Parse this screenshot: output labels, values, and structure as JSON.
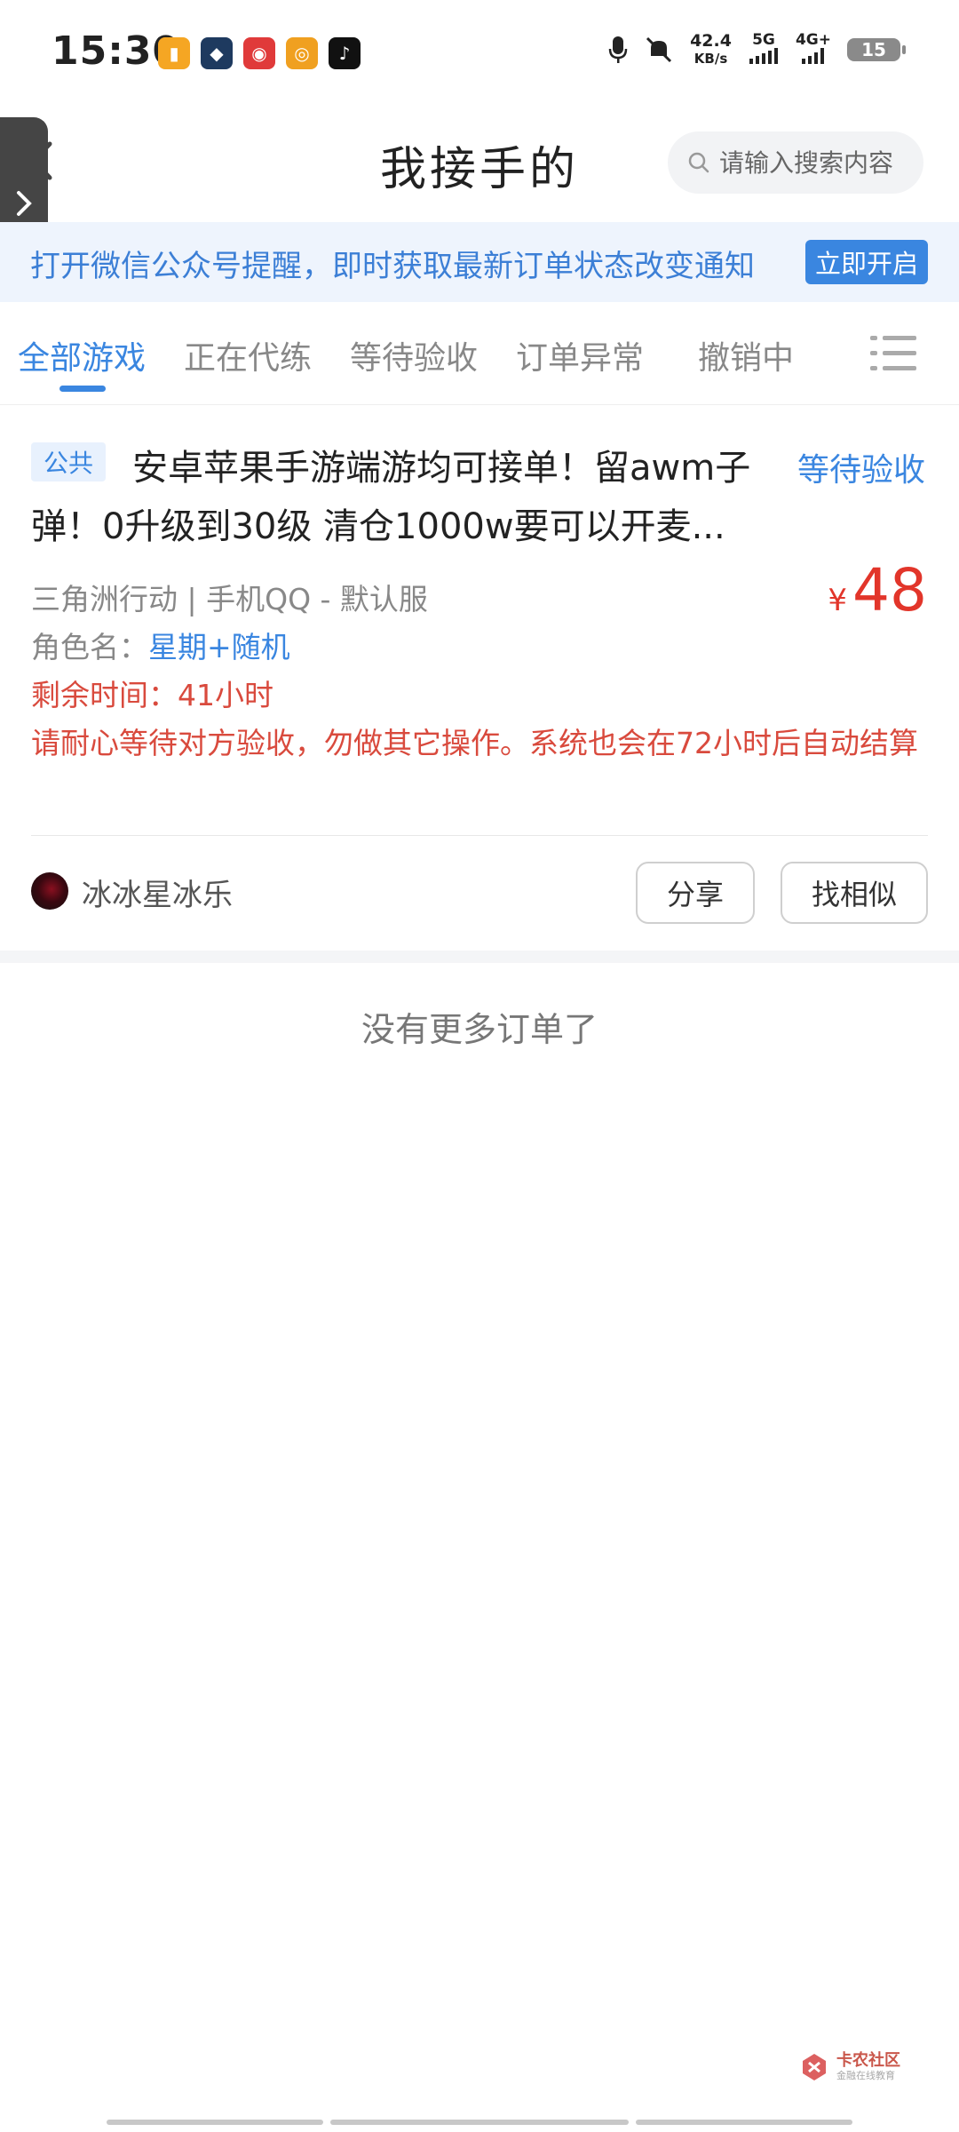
{
  "status_bar": {
    "time": "15:30",
    "net_speed_value": "42.4",
    "net_speed_unit": "KB/s",
    "signal_1": "5G",
    "signal_2": "4G+",
    "battery": "15"
  },
  "header": {
    "title": "我接手的",
    "search_placeholder": "请输入搜索内容"
  },
  "notice": {
    "text": "打开微信公众号提醒，即时获取最新订单状态改变通知",
    "button": "立即开启"
  },
  "tabs": [
    {
      "label": "全部游戏",
      "active": true
    },
    {
      "label": "正在代练",
      "active": false
    },
    {
      "label": "等待验收",
      "active": false
    },
    {
      "label": "订单异常",
      "active": false
    },
    {
      "label": "撤销中",
      "active": false
    }
  ],
  "order": {
    "badge": "公共",
    "title": "安卓苹果手游端游均可接单！留awm子弹！0升级到30级 清仓1000w要可以开麦...",
    "status": "等待验收",
    "game_info": "三角洲行动 | 手机QQ - 默认服",
    "price_symbol": "¥",
    "price": "48",
    "role_label": "角色名：",
    "role_value": "星期+随机",
    "remaining": "剩余时间：41小时",
    "notice": "请耐心等待对方验收，勿做其它操作。系统也会在72小时后自动结算",
    "username": "冰冰星冰乐",
    "share_button": "分享",
    "similar_button": "找相似"
  },
  "footer": {
    "no_more": "没有更多订单了"
  },
  "watermark": {
    "main": "卡农社区",
    "sub": "金融在线教育"
  },
  "colors": {
    "accent": "#3a86e0",
    "price": "#e2352a",
    "warning": "#d94a3d"
  }
}
